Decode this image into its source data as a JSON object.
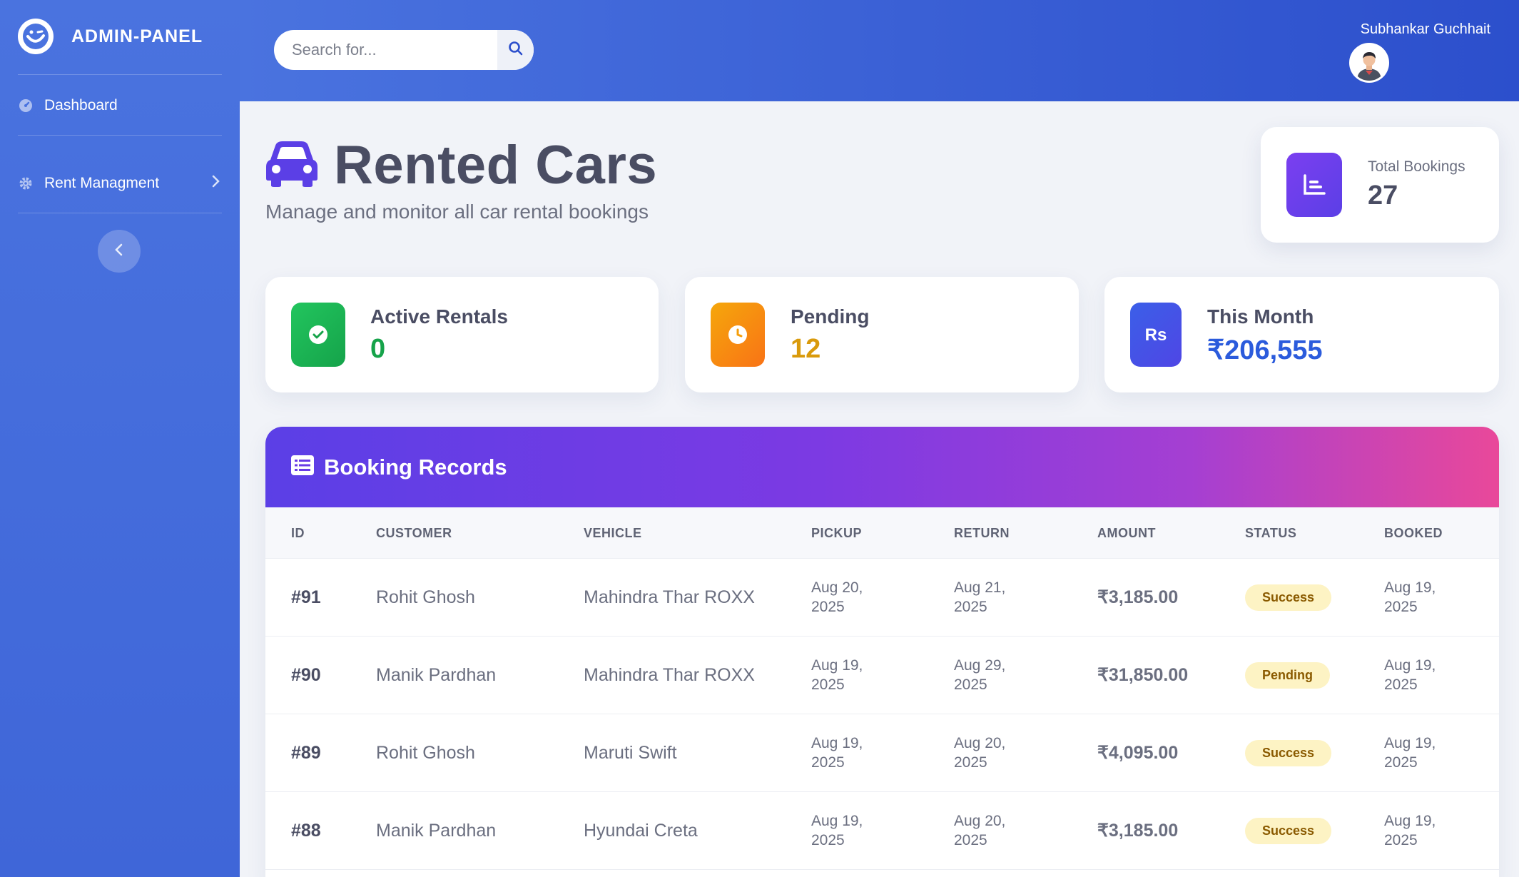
{
  "sidebar": {
    "brand": "ADMIN-PANEL",
    "items": [
      {
        "label": "Dashboard",
        "icon": "dashboard-icon"
      },
      {
        "label": "Rent Managment",
        "icon": "gear-icon"
      }
    ]
  },
  "topbar": {
    "search_placeholder": "Search for...",
    "user_name": "Subhankar Guchhait"
  },
  "page": {
    "title": "Rented Cars",
    "subtitle": "Manage and monitor all car rental bookings"
  },
  "total_bookings": {
    "label": "Total Bookings",
    "value": "27"
  },
  "stats": [
    {
      "label": "Active Rentals",
      "value": "0",
      "color": "#16a34a",
      "icon": "check-circle-icon"
    },
    {
      "label": "Pending",
      "value": "12",
      "color": "#d99a0b",
      "icon": "clock-icon"
    },
    {
      "label": "This Month",
      "value": "₹206,555",
      "color": "#2b5bdc",
      "icon": "rupee-icon"
    }
  ],
  "records": {
    "title": "Booking Records",
    "columns": [
      "ID",
      "CUSTOMER",
      "VEHICLE",
      "PICKUP",
      "RETURN",
      "AMOUNT",
      "STATUS",
      "BOOKED"
    ],
    "rows": [
      {
        "id": "#91",
        "customer": "Rohit Ghosh",
        "vehicle": "Mahindra Thar ROXX",
        "pickup": "Aug 20, 2025",
        "return": "Aug 21, 2025",
        "amount": "₹3,185.00",
        "status": "Success",
        "booked": "Aug 19, 2025"
      },
      {
        "id": "#90",
        "customer": "Manik Pardhan",
        "vehicle": "Mahindra Thar ROXX",
        "pickup": "Aug 19, 2025",
        "return": "Aug 29, 2025",
        "amount": "₹31,850.00",
        "status": "Pending",
        "booked": "Aug 19, 2025"
      },
      {
        "id": "#89",
        "customer": "Rohit Ghosh",
        "vehicle": "Maruti Swift",
        "pickup": "Aug 19, 2025",
        "return": "Aug 20, 2025",
        "amount": "₹4,095.00",
        "status": "Success",
        "booked": "Aug 19, 2025"
      },
      {
        "id": "#88",
        "customer": "Manik Pardhan",
        "vehicle": "Hyundai Creta",
        "pickup": "Aug 19, 2025",
        "return": "Aug 20, 2025",
        "amount": "₹3,185.00",
        "status": "Success",
        "booked": "Aug 19, 2025"
      }
    ]
  },
  "colors": {
    "sidebar": "#4a73df",
    "accent_purple": "#5b3fe6",
    "accent_pink": "#e9489a",
    "badge_bg": "#fdf3c4"
  }
}
